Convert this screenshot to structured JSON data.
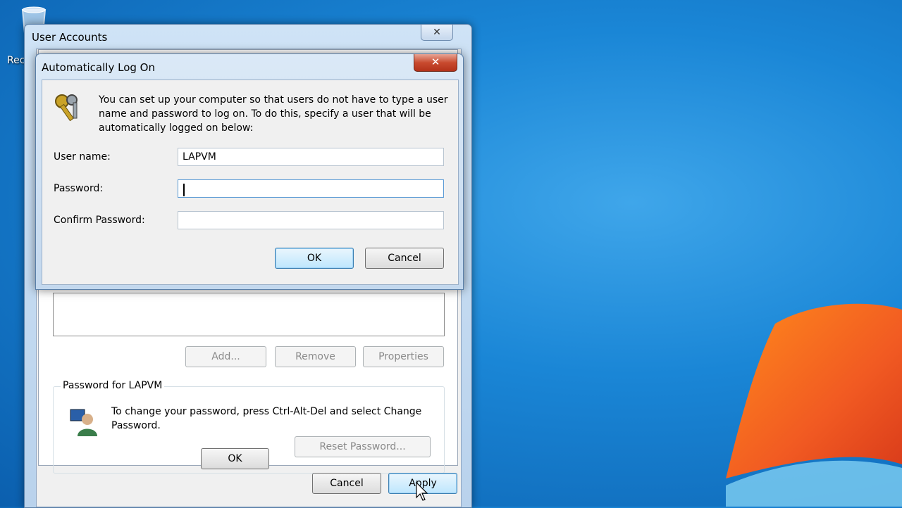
{
  "desktop": {
    "recycle_label": "Rec"
  },
  "outer_window": {
    "title": "User Accounts",
    "close_glyph": "✕",
    "buttons": {
      "add": "Add...",
      "remove": "Remove",
      "properties": "Properties"
    },
    "password_group": {
      "legend": "Password for LAPVM",
      "text": "To change your password, press Ctrl-Alt-Del and select Change Password.",
      "reset_button": "Reset Password..."
    },
    "footer": {
      "ok": "OK",
      "cancel": "Cancel",
      "apply": "Apply"
    }
  },
  "dialog": {
    "title": "Automatically Log On",
    "close_glyph": "✕",
    "intro": "You can set up your computer so that users do not have to type a user name and password to log on. To do this, specify a user that will be automatically logged on below:",
    "fields": {
      "username_label": "User name:",
      "username_value": "LAPVM",
      "password_label": "Password:",
      "password_value": "",
      "confirm_label": "Confirm Password:",
      "confirm_value": ""
    },
    "ok": "OK",
    "cancel": "Cancel"
  },
  "colors": {
    "desktop_blue": "#1a86d6",
    "close_red": "#c94a2f",
    "default_button": "#3c7fb1"
  },
  "icons": [
    "recycle-bin-icon",
    "windows-logo-icon",
    "keys-icon",
    "user-icon",
    "mouse-cursor-icon"
  ]
}
